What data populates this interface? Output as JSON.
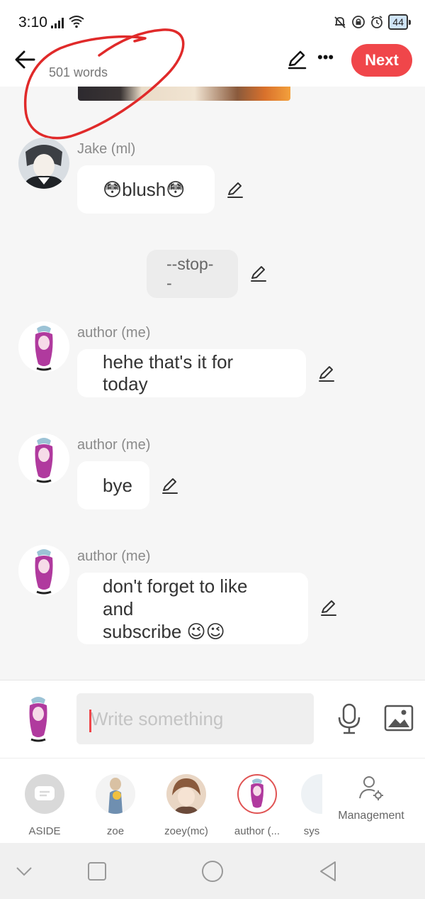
{
  "status": {
    "time": "3:10",
    "battery": "44"
  },
  "header": {
    "word_count": "501 words",
    "next_label": "Next",
    "more_label": "•••"
  },
  "messages": [
    {
      "sender": "Jake (ml)",
      "text": "😳blush😳"
    },
    {
      "text": "--stop--"
    },
    {
      "sender": "author (me)",
      "text": "hehe that's it for today"
    },
    {
      "sender": "author (me)",
      "text": "bye"
    },
    {
      "sender": "author (me)",
      "line1": "don't forget to like and",
      "line2": "subscribe 😉😉"
    }
  ],
  "composer": {
    "placeholder": "Write something"
  },
  "roles": [
    {
      "label": "ASIDE"
    },
    {
      "label": "zoe"
    },
    {
      "label": "zoey(mc)"
    },
    {
      "label": "author (..."
    },
    {
      "label": "sys"
    },
    {
      "label": "Management"
    }
  ],
  "colors": {
    "accent": "#f0464a",
    "background": "#f6f6f6",
    "bubble": "#ffffff",
    "annotation": "#e02a2a"
  }
}
